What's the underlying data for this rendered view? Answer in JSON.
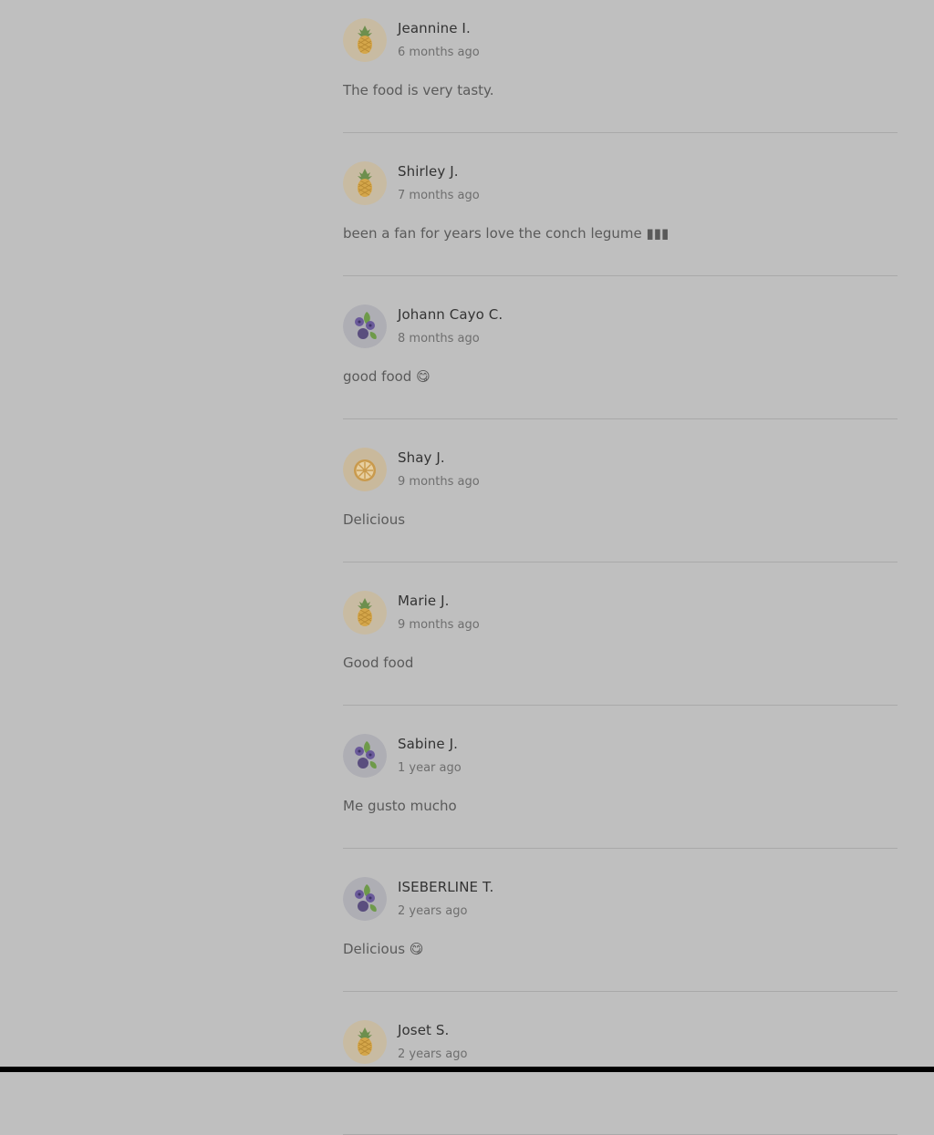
{
  "reviews": [
    {
      "name": "Jeannine I.",
      "time": "6 months ago",
      "text": "The food is very tasty.",
      "avatar": "pineapple-icon"
    },
    {
      "name": "Shirley J.",
      "time": "7 months ago",
      "text": "been a fan for years love the conch legume ▮▮▮",
      "avatar": "pineapple-icon"
    },
    {
      "name": "Johann Cayo C.",
      "time": "8 months ago",
      "text": "good food 😋",
      "avatar": "blueberry-icon"
    },
    {
      "name": "Shay J.",
      "time": "9 months ago",
      "text": "Delicious",
      "avatar": "orange-slice-icon"
    },
    {
      "name": "Marie J.",
      "time": "9 months ago",
      "text": "Good food",
      "avatar": "pineapple-icon"
    },
    {
      "name": "Sabine J.",
      "time": "1 year ago",
      "text": "Me gusto mucho",
      "avatar": "blueberry-icon"
    },
    {
      "name": "ISEBERLINE T.",
      "time": "2 years ago",
      "text": "Delicious 😋",
      "avatar": "blueberry-icon"
    },
    {
      "name": "Joset S.",
      "time": "2 years ago",
      "text": "",
      "avatar": "pineapple-icon"
    }
  ],
  "colors": {
    "background": "#bfbfbf",
    "pineapple_bg": "#c8bba2",
    "blueberry_bg": "#aeaeb4",
    "orange_bg": "#c9b99c"
  }
}
